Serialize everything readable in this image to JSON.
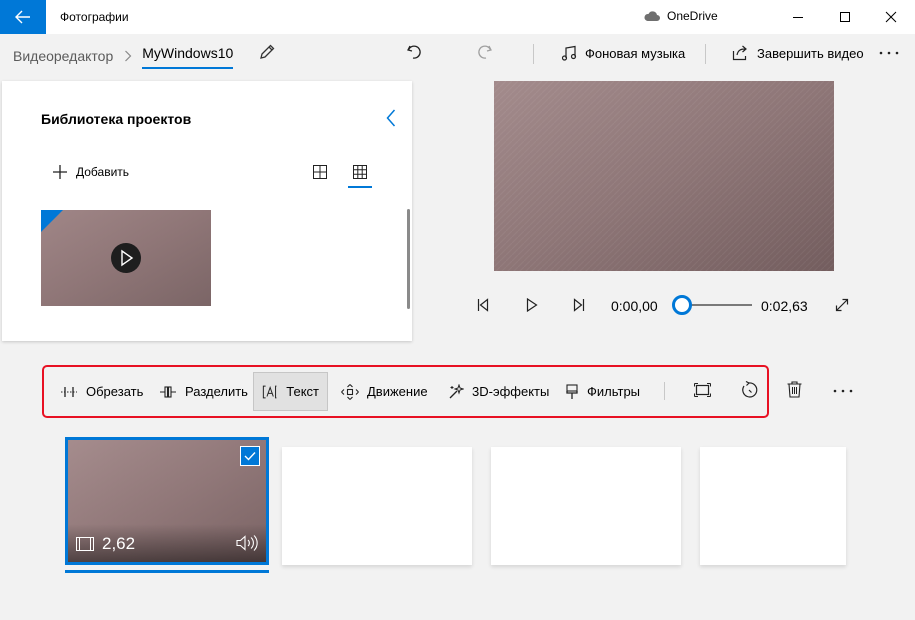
{
  "window": {
    "app_title": "Фотографии",
    "onedrive_label": "OneDrive"
  },
  "header": {
    "breadcrumb_root": "Видеоредактор",
    "project_name": "MyWindows10",
    "background_music": "Фоновая музыка",
    "finish_video": "Завершить видео"
  },
  "library": {
    "title": "Библиотека проектов",
    "add_label": "Добавить"
  },
  "player": {
    "current_time": "0:00,00",
    "total_time": "0:02,63",
    "progress": 0
  },
  "storyboard_toolbar": {
    "trim": "Обрезать",
    "split": "Разделить",
    "text": "Текст",
    "motion": "Движение",
    "effects_3d": "3D-эффекты",
    "filters": "Фильтры"
  },
  "storyboard": {
    "clip_duration": "2,62"
  },
  "colors": {
    "accent": "#0078d7",
    "highlight_frame": "#e81123"
  }
}
